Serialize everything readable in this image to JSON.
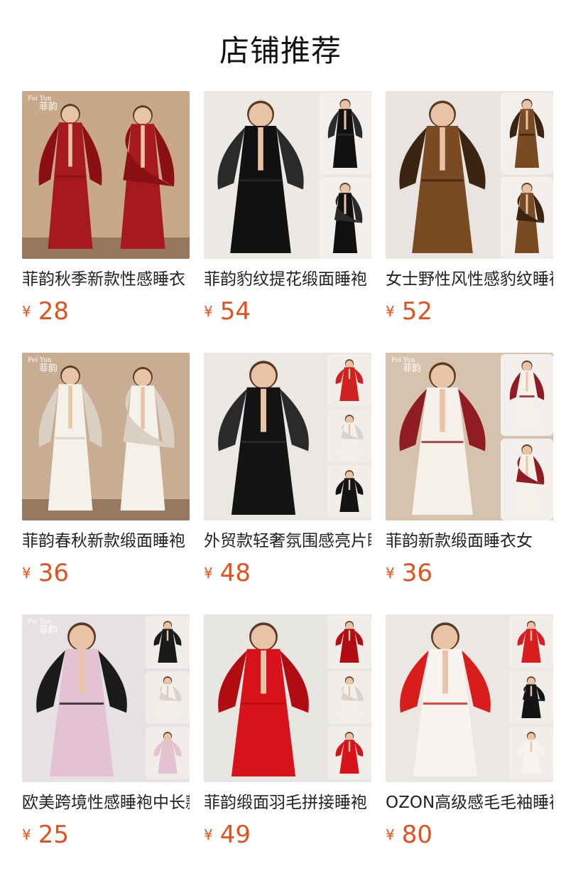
{
  "page": {
    "title": "店铺推荐"
  },
  "products": [
    {
      "name": "菲韵秋季新款性感睡衣",
      "price": "28",
      "currency": "¥",
      "watermark": [
        "Fei Yun",
        "菲韵"
      ],
      "theme": {
        "bg": "#c8a889",
        "main": "#a5191f",
        "accent": "#8b1014"
      }
    },
    {
      "name": "菲韵豹纹提花缎面睡袍",
      "price": "54",
      "currency": "¥",
      "theme": {
        "bg": "#ece8e4",
        "main": "#111111",
        "accent": "#2a2a2a"
      }
    },
    {
      "name": "女士野性风性感豹纹睡袍",
      "price": "52",
      "currency": "¥",
      "theme": {
        "bg": "#e9e4df",
        "main": "#7a4a22",
        "accent": "#3b2410"
      }
    },
    {
      "name": "菲韵春秋新款缎面睡袍",
      "price": "36",
      "currency": "¥",
      "watermark": [
        "Fei Yun",
        "菲韵"
      ],
      "theme": {
        "bg": "#c9ad92",
        "main": "#f4f0ea",
        "accent": "#d9cfc2"
      }
    },
    {
      "name": "外贸款轻奢氛围感亮片睡袍",
      "price": "48",
      "currency": "¥",
      "theme": {
        "bg": "#ebe8e3",
        "main": "#141414",
        "accent": "#d12020"
      }
    },
    {
      "name": "菲韵新款缎面睡衣女",
      "price": "36",
      "currency": "¥",
      "watermark": [
        "Fei Yun",
        "菲韵"
      ],
      "theme": {
        "bg": "#d6c3ad",
        "main": "#f5f1ea",
        "accent": "#8f1b24"
      }
    },
    {
      "name": "欧美跨境性感睡袍中长款",
      "price": "25",
      "currency": "¥",
      "watermark": [
        "Fei Yun",
        "菲韵"
      ],
      "theme": {
        "bg": "#e7e1e6",
        "main": "#e3c3d2",
        "accent": "#1b1b1b"
      }
    },
    {
      "name": "菲韵缎面羽毛拼接睡袍",
      "price": "49",
      "currency": "¥",
      "theme": {
        "bg": "#e8e6e3",
        "main": "#d8121a",
        "accent": "#b00c12"
      }
    },
    {
      "name": "OZON高级感毛毛袖睡袍",
      "price": "80",
      "currency": "¥",
      "theme": {
        "bg": "#ece7e2",
        "main": "#f7f4ef",
        "accent": "#d91c1c"
      }
    }
  ]
}
